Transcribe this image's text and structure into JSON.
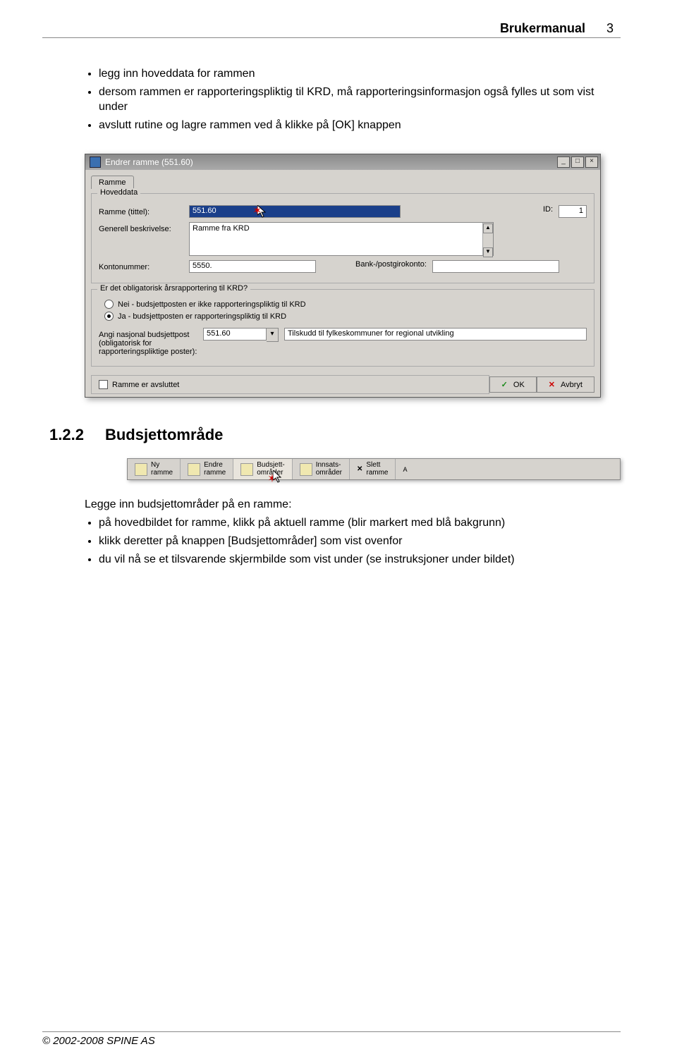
{
  "header": {
    "title": "Brukermanual",
    "page": "3"
  },
  "bullets_top": [
    "legg inn hoveddata for rammen",
    "dersom rammen er rapporteringspliktig til KRD, må rapporteringsinformasjon også fylles ut som vist under",
    "avslutt rutine og lagre rammen ved å klikke på [OK] knappen"
  ],
  "dialog": {
    "title": "Endrer ramme  (551.60)",
    "tab": "Ramme",
    "group1_title": "Hoveddata",
    "labels": {
      "ramme_tittel": "Ramme (tittel):",
      "generell": "Generell beskrivelse:",
      "kontonummer": "Kontonummer:",
      "bank": "Bank-/postgirokonto:",
      "id": "ID:"
    },
    "values": {
      "ramme_tittel": "551.60",
      "generell": "Ramme fra KRD",
      "kontonummer": "5550.",
      "bank": "",
      "id": "1"
    },
    "group2_title": "Er det obligatorisk årsrapportering til KRD?",
    "radio_nei": "Nei - budsjettposten er ikke rapporteringspliktig til KRD",
    "radio_ja": "Ja - budsjettposten er rapporteringspliktig til KRD",
    "angi_label": "Angi nasjonal budsjettpost (obligatorisk for rapporteringspliktige poster):",
    "angi_value": "551.60",
    "angi_desc": "Tilskudd til fylkeskommuner for regional utvikling",
    "avsluttet": "Ramme er avsluttet",
    "ok": "OK",
    "avbryt": "Avbryt"
  },
  "section": {
    "num": "1.2.2",
    "title": "Budsjettområde"
  },
  "toolbar": {
    "ny": {
      "l1": "Ny",
      "l2": "ramme"
    },
    "endre": {
      "l1": "Endre",
      "l2": "ramme"
    },
    "budsjett": {
      "l1": "Budsjett-",
      "l2": "områder"
    },
    "innsats": {
      "l1": "Innsats-",
      "l2": "områder"
    },
    "slett": {
      "l1": "Slett",
      "l2": "ramme"
    }
  },
  "para_before_list": "Legge inn budsjettområder på en ramme:",
  "bullets_bottom": [
    "på hovedbildet for ramme, klikk på aktuell ramme (blir markert med blå bakgrunn)",
    "klikk deretter på knappen [Budsjettområder] som vist ovenfor",
    "du vil nå se et tilsvarende skjermbilde som vist under (se instruksjoner under bildet)"
  ],
  "footer": "© 2002-2008  SPINE AS"
}
